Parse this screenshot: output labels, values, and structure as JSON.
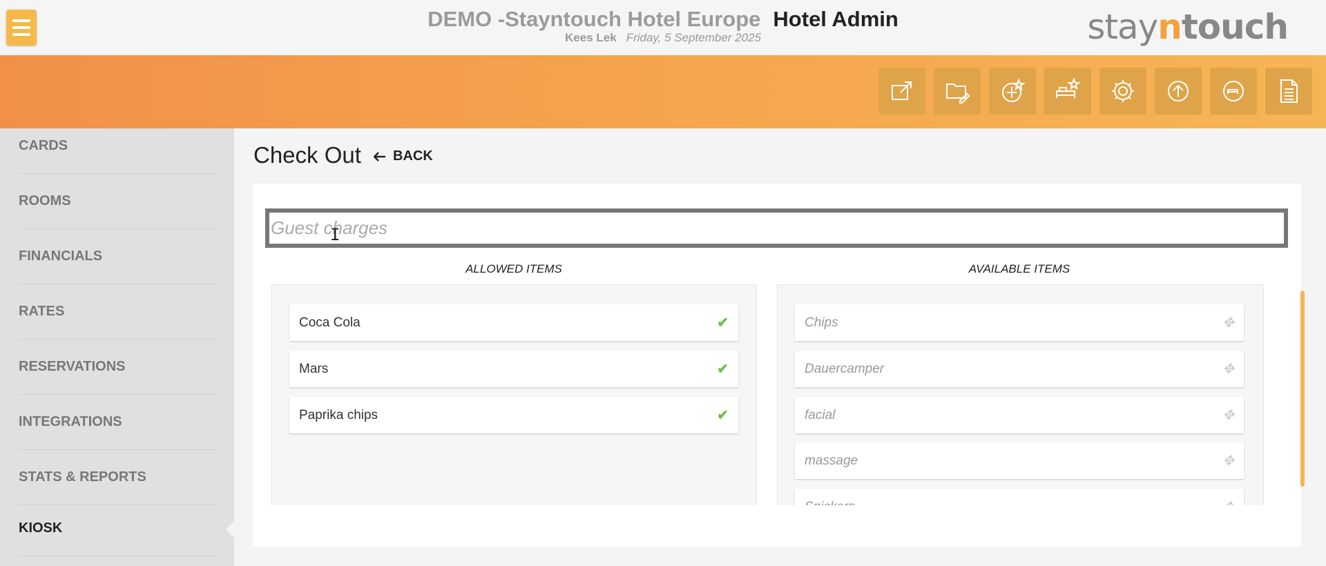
{
  "header": {
    "hotel_name": "DEMO -Stayntouch Hotel Europe",
    "app_label": "Hotel Admin",
    "user_name": "Kees Lek",
    "date": "Friday, 5 September 2025",
    "logo": {
      "part1": "stay",
      "part2": "n",
      "part3": "touch"
    }
  },
  "toolbar": {
    "icons": [
      "external-link-icon",
      "folder-edit-icon",
      "rate-star-icon",
      "bed-star-icon",
      "settings-gear-icon",
      "upload-icon",
      "reservation-icon",
      "document-icon"
    ]
  },
  "sidebar": {
    "items": [
      {
        "label": "CARDS"
      },
      {
        "label": "ROOMS"
      },
      {
        "label": "FINANCIALS"
      },
      {
        "label": "RATES"
      },
      {
        "label": "RESERVATIONS"
      },
      {
        "label": "INTEGRATIONS"
      },
      {
        "label": "STATS & REPORTS"
      },
      {
        "label": "KIOSK"
      }
    ],
    "active": "KIOSK"
  },
  "main": {
    "title": "Check Out",
    "back_label": "BACK",
    "name_input": {
      "value": "",
      "placeholder": "Guest charges"
    },
    "allowed_header": "ALLOWED ITEMS",
    "available_header": "AVAILABLE ITEMS",
    "allowed_items": [
      {
        "label": "Coca Cola"
      },
      {
        "label": "Mars"
      },
      {
        "label": "Paprika chips"
      }
    ],
    "available_items": [
      {
        "label": "Chips"
      },
      {
        "label": "Dauercamper"
      },
      {
        "label": "facial"
      },
      {
        "label": "massage"
      },
      {
        "label": "Snickers"
      }
    ]
  },
  "colors": {
    "accent_orange": "#f29048",
    "accent_yellow": "#f6b554",
    "check_green": "#6fbf4c"
  }
}
